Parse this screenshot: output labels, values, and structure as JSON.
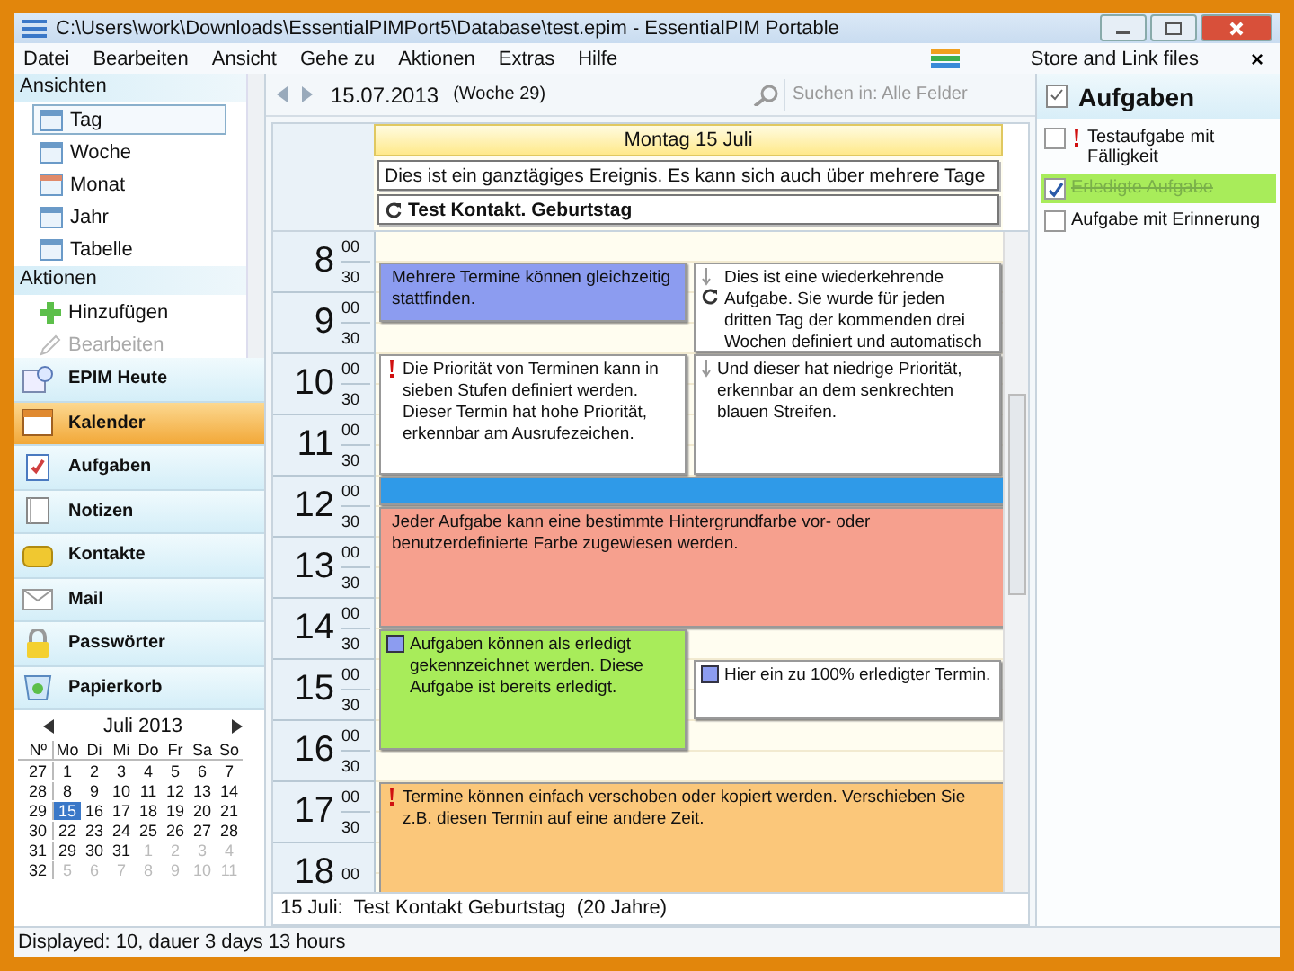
{
  "window": {
    "title": "C:\\Users\\work\\Downloads\\EssentialPIMPort5\\Database\\test.epim - EssentialPIM Portable"
  },
  "menu": [
    "Datei",
    "Bearbeiten",
    "Ansicht",
    "Gehe zu",
    "Aktionen",
    "Extras",
    "Hilfe"
  ],
  "toolbar": {
    "store_link": "Store and Link files",
    "close": "×"
  },
  "sidebar": {
    "views_header": "Ansichten",
    "views": [
      {
        "label": "Tag",
        "selected": true
      },
      {
        "label": "Woche",
        "selected": false
      },
      {
        "label": "Monat",
        "selected": false
      },
      {
        "label": "Jahr",
        "selected": false
      },
      {
        "label": "Tabelle",
        "selected": false
      }
    ],
    "actions_header": "Aktionen",
    "actions": [
      {
        "label": "Hinzufügen",
        "disabled": false
      },
      {
        "label": "Bearbeiten",
        "disabled": true
      }
    ]
  },
  "modules": [
    {
      "label": "EPIM Heute",
      "selected": false
    },
    {
      "label": "Kalender",
      "selected": true
    },
    {
      "label": "Aufgaben",
      "selected": false
    },
    {
      "label": "Notizen",
      "selected": false
    },
    {
      "label": "Kontakte",
      "selected": false
    },
    {
      "label": "Mail",
      "selected": false
    },
    {
      "label": "Passwörter",
      "selected": false
    },
    {
      "label": "Papierkorb",
      "selected": false
    }
  ],
  "mini_calendar": {
    "month": "Juli  2013",
    "week_header": "Nº",
    "weekdays": [
      "Mo",
      "Di",
      "Mi",
      "Do",
      "Fr",
      "Sa",
      "So"
    ],
    "weeks": [
      {
        "no": "27",
        "days": [
          {
            "d": "1",
            "muted": false,
            "selected": false
          },
          {
            "d": "2",
            "muted": false,
            "selected": false
          },
          {
            "d": "3",
            "muted": false,
            "selected": false
          },
          {
            "d": "4",
            "muted": false,
            "selected": false
          },
          {
            "d": "5",
            "muted": false,
            "selected": false
          },
          {
            "d": "6",
            "muted": false,
            "selected": false
          },
          {
            "d": "7",
            "muted": false,
            "selected": false
          }
        ]
      },
      {
        "no": "28",
        "days": [
          {
            "d": "8",
            "muted": false,
            "selected": false
          },
          {
            "d": "9",
            "muted": false,
            "selected": false
          },
          {
            "d": "10",
            "muted": false,
            "selected": false
          },
          {
            "d": "11",
            "muted": false,
            "selected": false
          },
          {
            "d": "12",
            "muted": false,
            "selected": false
          },
          {
            "d": "13",
            "muted": false,
            "selected": false
          },
          {
            "d": "14",
            "muted": false,
            "selected": false
          }
        ]
      },
      {
        "no": "29",
        "days": [
          {
            "d": "15",
            "muted": false,
            "selected": true
          },
          {
            "d": "16",
            "muted": false,
            "selected": false
          },
          {
            "d": "17",
            "muted": false,
            "selected": false
          },
          {
            "d": "18",
            "muted": false,
            "selected": false
          },
          {
            "d": "19",
            "muted": false,
            "selected": false
          },
          {
            "d": "20",
            "muted": false,
            "selected": false
          },
          {
            "d": "21",
            "muted": false,
            "selected": false
          }
        ]
      },
      {
        "no": "30",
        "days": [
          {
            "d": "22",
            "muted": false,
            "selected": false
          },
          {
            "d": "23",
            "muted": false,
            "selected": false
          },
          {
            "d": "24",
            "muted": false,
            "selected": false
          },
          {
            "d": "25",
            "muted": false,
            "selected": false
          },
          {
            "d": "26",
            "muted": false,
            "selected": false
          },
          {
            "d": "27",
            "muted": false,
            "selected": false
          },
          {
            "d": "28",
            "muted": false,
            "selected": false
          }
        ]
      },
      {
        "no": "31",
        "days": [
          {
            "d": "29",
            "muted": false,
            "selected": false
          },
          {
            "d": "30",
            "muted": false,
            "selected": false
          },
          {
            "d": "31",
            "muted": false,
            "selected": false
          },
          {
            "d": "1",
            "muted": true,
            "selected": false
          },
          {
            "d": "2",
            "muted": true,
            "selected": false
          },
          {
            "d": "3",
            "muted": true,
            "selected": false
          },
          {
            "d": "4",
            "muted": true,
            "selected": false
          }
        ]
      },
      {
        "no": "32",
        "days": [
          {
            "d": "5",
            "muted": true,
            "selected": false
          },
          {
            "d": "6",
            "muted": true,
            "selected": false
          },
          {
            "d": "7",
            "muted": true,
            "selected": false
          },
          {
            "d": "8",
            "muted": true,
            "selected": false
          },
          {
            "d": "9",
            "muted": true,
            "selected": false
          },
          {
            "d": "10",
            "muted": true,
            "selected": false
          },
          {
            "d": "11",
            "muted": true,
            "selected": false
          }
        ]
      }
    ]
  },
  "calendar": {
    "date": "15.07.2013",
    "week": "(Woche 29)",
    "search": {
      "placeholder": "Suchen in: Alle Felder"
    },
    "day_header": "Montag 15 Juli",
    "all_day": [
      {
        "text": "Dies ist ein ganztägiges Ereignis. Es kann sich auch über mehrere Tage",
        "bold": false
      },
      {
        "text": "Test Kontakt. Geburtstag",
        "bold": true,
        "recurring": true
      }
    ],
    "hours": [
      {
        "hour": "8",
        "marks": [
          "00",
          "30"
        ]
      },
      {
        "hour": "9",
        "marks": [
          "00",
          "30"
        ]
      },
      {
        "hour": "10",
        "marks": [
          "00",
          "30"
        ]
      },
      {
        "hour": "11",
        "marks": [
          "00",
          "30"
        ]
      },
      {
        "hour": "12",
        "marks": [
          "00",
          "30"
        ]
      },
      {
        "hour": "13",
        "marks": [
          "00",
          "30"
        ]
      },
      {
        "hour": "14",
        "marks": [
          "00",
          "30"
        ]
      },
      {
        "hour": "15",
        "marks": [
          "00",
          "30"
        ]
      },
      {
        "hour": "16",
        "marks": [
          "00",
          "30"
        ]
      },
      {
        "hour": "17",
        "marks": [
          "00",
          "30"
        ]
      },
      {
        "hour": "18",
        "marks": [
          "00"
        ]
      }
    ],
    "events": [
      {
        "text": "Mehrere Termine können gleichzeitig stattfinden.",
        "color": "#8c9cf0"
      },
      {
        "text": "Dies ist eine wiederkehrende Aufgabe. Sie wurde für jeden dritten Tag der kommenden drei Wochen definiert und automatisch",
        "color": "#ffffff",
        "low_priority": true,
        "recurring": true
      },
      {
        "text": "Die Priorität von Terminen kann in sieben Stufen definiert werden. Dieser Termin hat hohe Priorität, erkennbar am Ausrufezeichen.",
        "color": "#ffffff",
        "high_priority": true
      },
      {
        "text": "Und dieser hat niedrige Priorität, erkennbar an dem senkrechten blauen Streifen.",
        "color": "#ffffff",
        "low_priority": true
      },
      {
        "color": "#2f9ae8"
      },
      {
        "text": "Jeder Aufgabe kann eine bestimmte Hintergrundfarbe vor- oder benutzerdefinierte Farbe zugewiesen werden.",
        "color": "#f6a08e"
      },
      {
        "text": "Aufgaben können als erledigt gekennzeichnet werden. Diese Aufgabe ist bereits erledigt.",
        "color": "#a8ec5a",
        "task": true
      },
      {
        "text": "Hier ein zu 100% erledigter Termin.",
        "color": "#ffffff",
        "task": true
      },
      {
        "text": "Termine können einfach verschoben oder kopiert werden. Verschieben Sie z.B. diesen Termin auf eine andere Zeit.",
        "color": "#fbc77a",
        "high_priority": true
      }
    ],
    "footer": "15 Juli:  Test Kontakt Geburtstag  (20 Jahre)"
  },
  "tasks": {
    "title": "Aufgaben",
    "items": [
      {
        "label": "Testaufgabe mit Fälligkeit",
        "checked": false,
        "high_priority": true
      },
      {
        "label": "Erledigte Aufgabe",
        "checked": true
      },
      {
        "label": "Aufgabe mit Erinnerung",
        "checked": false
      }
    ]
  },
  "status_bar": "Displayed: 10, dauer 3 days 13 hours"
}
